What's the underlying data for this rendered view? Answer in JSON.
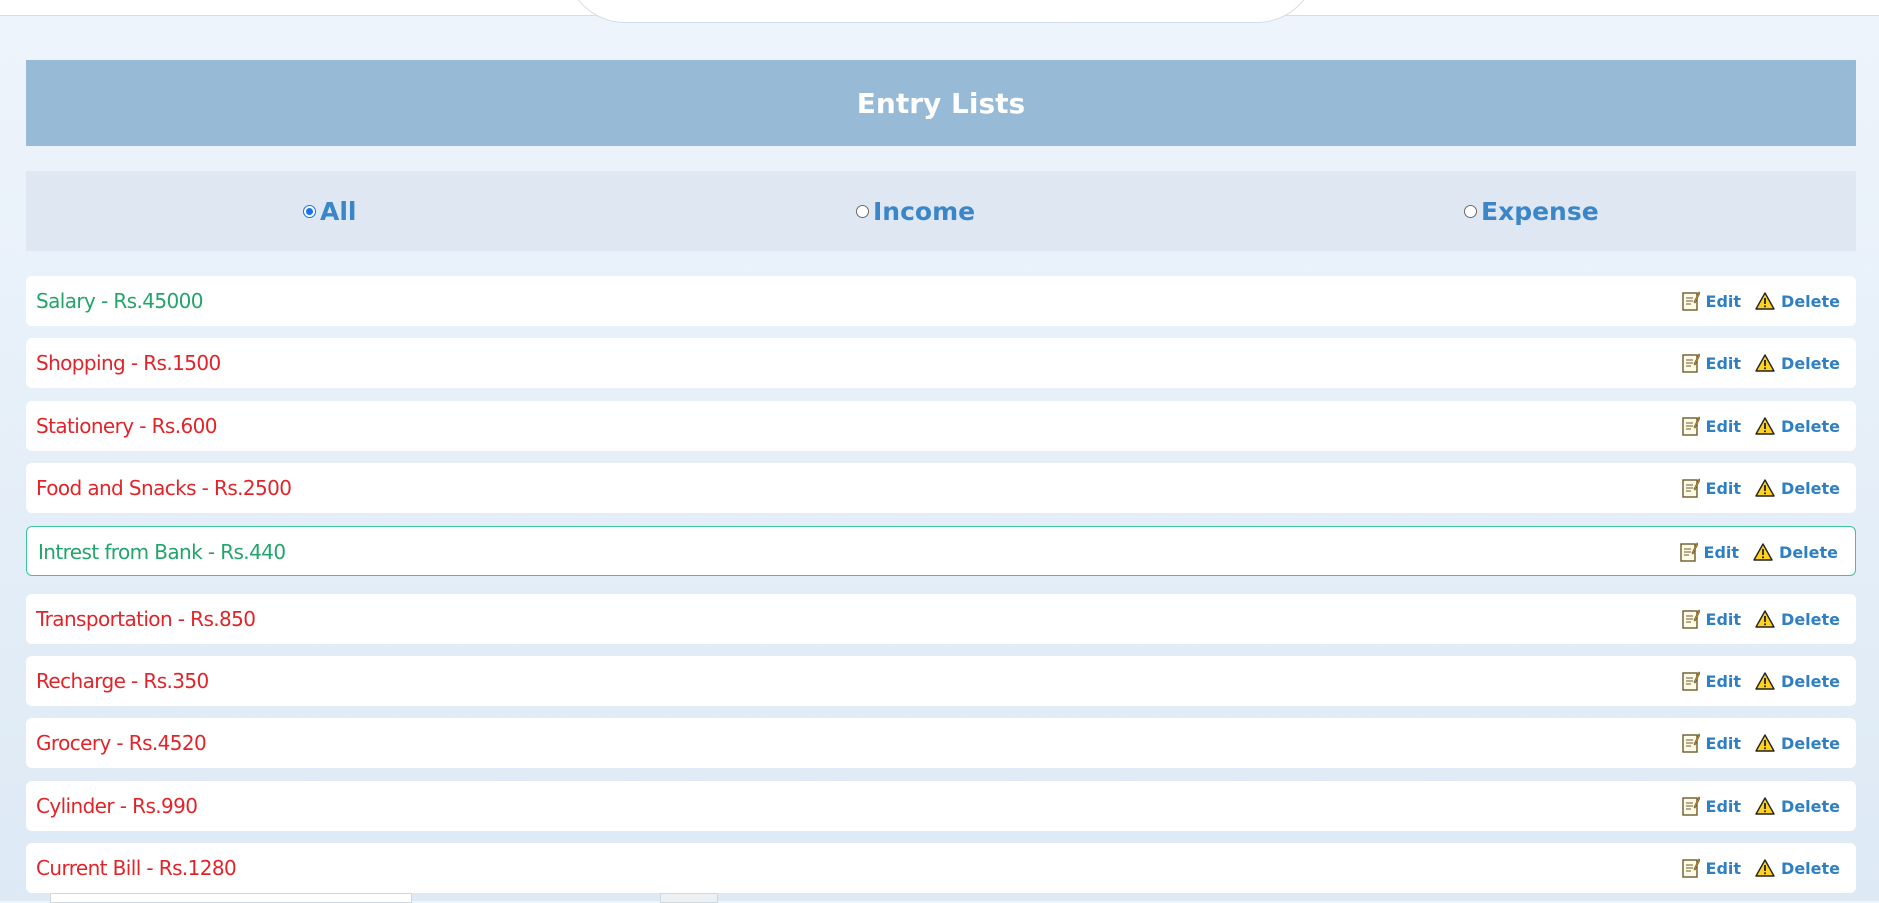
{
  "header": {
    "title": "Entry Lists"
  },
  "filter": {
    "options": [
      {
        "label": "All",
        "checked": true
      },
      {
        "label": "Income",
        "checked": false
      },
      {
        "label": "Expense",
        "checked": false
      }
    ]
  },
  "entries": [
    {
      "text": "Salary - Rs.45000",
      "type": "income"
    },
    {
      "text": "Shopping - Rs.1500",
      "type": "expense"
    },
    {
      "text": "Stationery - Rs.600",
      "type": "expense"
    },
    {
      "text": "Food and Snacks - Rs.2500",
      "type": "expense"
    },
    {
      "text": "Intrest from Bank - Rs.440",
      "type": "income"
    },
    {
      "text": "Transportation - Rs.850",
      "type": "expense"
    },
    {
      "text": "Recharge - Rs.350",
      "type": "expense"
    },
    {
      "text": "Grocery - Rs.4520",
      "type": "expense"
    },
    {
      "text": "Cylinder - Rs.990",
      "type": "expense"
    },
    {
      "text": "Current Bill - Rs.1280",
      "type": "expense"
    }
  ],
  "actions": {
    "edit_label": "Edit",
    "delete_label": "Delete"
  },
  "icons": {
    "edit": "memo-icon",
    "delete": "warning-icon"
  },
  "colors": {
    "header_bg": "#97bbd7",
    "filter_bg": "#dfe8f2",
    "income_text": "#22a46a",
    "expense_text": "#e0242a",
    "action_text": "#2f7fc3",
    "active_border": "#3fc39a",
    "radio_selected": "#1a73e8"
  }
}
